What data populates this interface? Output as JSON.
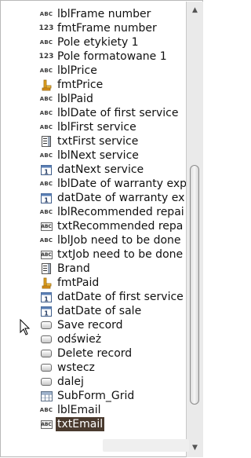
{
  "items": [
    {
      "icon": "abc-label-icon",
      "label": "lblFrame number"
    },
    {
      "icon": "123-formatted-icon",
      "label": "fmtFrame number"
    },
    {
      "icon": "abc-label-icon",
      "label": "Pole etykiety 1"
    },
    {
      "icon": "123-formatted-icon",
      "label": "Pole formatowane 1"
    },
    {
      "icon": "abc-label-icon",
      "label": "lblPrice"
    },
    {
      "icon": "currency-icon",
      "label": "fmtPrice"
    },
    {
      "icon": "abc-label-icon",
      "label": "lblPaid"
    },
    {
      "icon": "abc-label-icon",
      "label": "lblDate of first service"
    },
    {
      "icon": "abc-label-icon",
      "label": "lblFirst service"
    },
    {
      "icon": "listbox-icon",
      "label": "txtFirst service"
    },
    {
      "icon": "abc-label-icon",
      "label": "lblNext service"
    },
    {
      "icon": "date-field-icon",
      "label": "datNext service"
    },
    {
      "icon": "abc-label-icon",
      "label": "lblDate of warranty exp"
    },
    {
      "icon": "date-field-icon",
      "label": "datDate of warranty ex"
    },
    {
      "icon": "abc-label-icon",
      "label": "lblRecommended repai"
    },
    {
      "icon": "text-field-icon",
      "label": "txtRecommended repa"
    },
    {
      "icon": "abc-label-icon",
      "label": "lblJob need to be done"
    },
    {
      "icon": "text-field-icon",
      "label": "txtJob need to be done"
    },
    {
      "icon": "listbox-icon",
      "label": "Brand"
    },
    {
      "icon": "currency-icon",
      "label": "fmtPaid"
    },
    {
      "icon": "date-field-icon",
      "label": "datDate of first service"
    },
    {
      "icon": "date-field-icon",
      "label": "datDate of sale"
    },
    {
      "icon": "push-button-icon",
      "label": "Save record"
    },
    {
      "icon": "push-button-icon",
      "label": "odśwież"
    },
    {
      "icon": "push-button-icon",
      "label": "Delete record"
    },
    {
      "icon": "push-button-icon",
      "label": "wstecz"
    },
    {
      "icon": "push-button-icon",
      "label": "dalej"
    },
    {
      "icon": "grid-icon",
      "label": "SubForm_Grid"
    },
    {
      "icon": "abc-label-icon",
      "label": "lblEmail"
    },
    {
      "icon": "text-field-icon",
      "label": "txtEmail"
    }
  ],
  "selected_index": 29,
  "colors": {
    "selection": "#4a3a2e",
    "background": "#ffffff"
  }
}
